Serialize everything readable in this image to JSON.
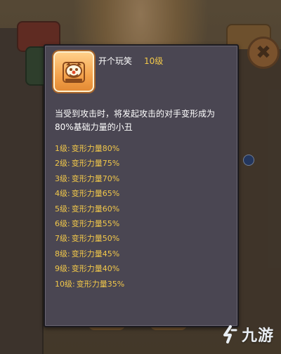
{
  "background": {
    "close_glyph": "✖"
  },
  "tooltip": {
    "icon": "clown-mask-icon",
    "skill_name": "开个玩笑",
    "skill_level": "10级",
    "description": "当受到攻击时，将发起攻击的对手变形成为\n80%基础力量的小丑",
    "levels": [
      {
        "level": "1级:",
        "effect": "变形力量80%"
      },
      {
        "level": "2级:",
        "effect": "变形力量75%"
      },
      {
        "level": "3级:",
        "effect": "变形力量70%"
      },
      {
        "level": "4级:",
        "effect": "变形力量65%"
      },
      {
        "level": "5级:",
        "effect": "变形力量60%"
      },
      {
        "level": "6级:",
        "effect": "变形力量55%"
      },
      {
        "level": "7级:",
        "effect": "变形力量50%"
      },
      {
        "level": "8级:",
        "effect": "变形力量45%"
      },
      {
        "level": "9级:",
        "effect": "变形力量40%"
      },
      {
        "level": "10级:",
        "effect": "变形力量35%"
      }
    ]
  },
  "watermark": {
    "text": "九游"
  },
  "colors": {
    "tooltip_bg": "#4a4652",
    "accent_gold": "#f2c84a",
    "icon_orange": "#f4a34c"
  }
}
